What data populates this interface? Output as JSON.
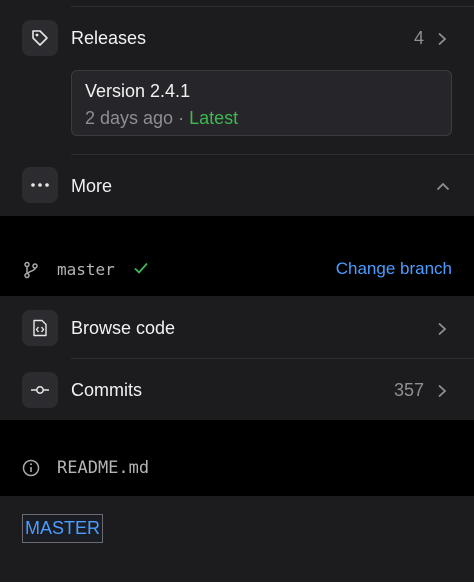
{
  "releases": {
    "label": "Releases",
    "count": "4",
    "latest": {
      "version": "Version 2.4.1",
      "age": "2 days ago",
      "separator": " · ",
      "badge": "Latest"
    }
  },
  "more": {
    "label": "More"
  },
  "branch": {
    "name": "master",
    "action": "Change branch"
  },
  "code": {
    "browse_label": "Browse code",
    "commits_label": "Commits",
    "commits_count": "357"
  },
  "readme": {
    "label": "README.md"
  },
  "content": {
    "heading": "MASTER"
  },
  "colors": {
    "accent": "#4b9dff",
    "success": "#3fb950",
    "card": "#1c1c1f",
    "muted": "#8e8e93"
  }
}
